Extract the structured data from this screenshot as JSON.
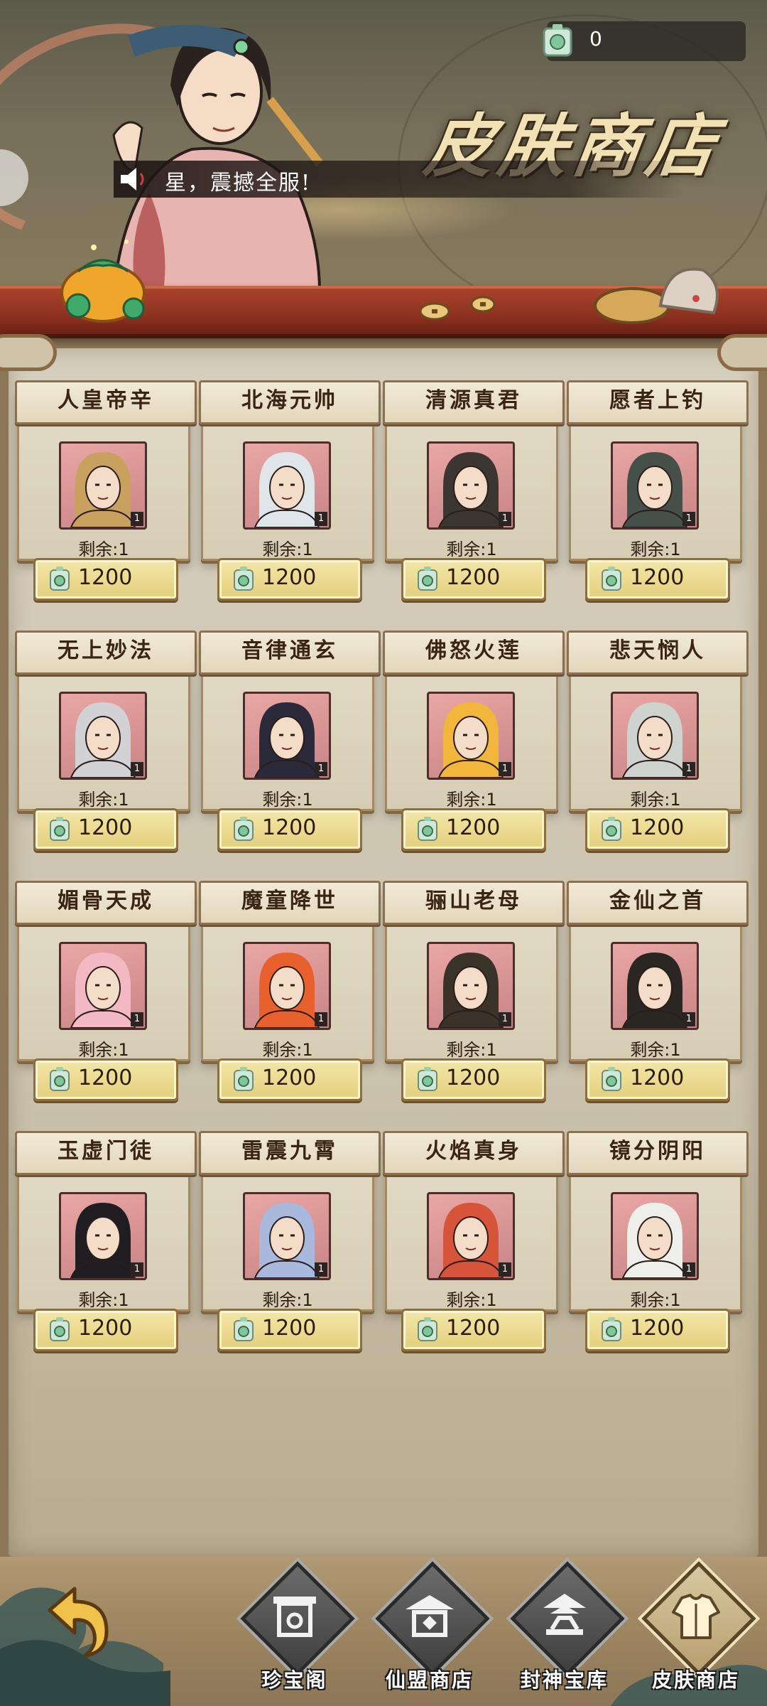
{
  "header": {
    "currency_value": "0",
    "shop_title": "皮肤商店",
    "announcement": "星，震撼全服!",
    "icons": [
      "jade-currency-icon",
      "speaker-icon",
      "money-bag-icon",
      "coins-icon",
      "sack-icon"
    ]
  },
  "items": [
    {
      "name": "人皇帝辛",
      "remaining": "剩余:1",
      "price": "1200",
      "stock": "1",
      "tone": "#c9a15e"
    },
    {
      "name": "北海元帅",
      "remaining": "剩余:1",
      "price": "1200",
      "stock": "1",
      "tone": "#dfe6ea"
    },
    {
      "name": "清源真君",
      "remaining": "剩余:1",
      "price": "1200",
      "stock": "1",
      "tone": "#3b3631"
    },
    {
      "name": "愿者上钓",
      "remaining": "剩余:1",
      "price": "1200",
      "stock": "1",
      "tone": "#46504a"
    },
    {
      "name": "无上妙法",
      "remaining": "剩余:1",
      "price": "1200",
      "stock": "1",
      "tone": "#d2d2d6"
    },
    {
      "name": "音律通玄",
      "remaining": "剩余:1",
      "price": "1200",
      "stock": "1",
      "tone": "#2b2a3a"
    },
    {
      "name": "佛怒火莲",
      "remaining": "剩余:1",
      "price": "1200",
      "stock": "1",
      "tone": "#f2b63a"
    },
    {
      "name": "悲天悯人",
      "remaining": "剩余:1",
      "price": "1200",
      "stock": "1",
      "tone": "#cfd3cf"
    },
    {
      "name": "媚骨天成",
      "remaining": "剩余:1",
      "price": "1200",
      "stock": "1",
      "tone": "#f3b9c2"
    },
    {
      "name": "魔童降世",
      "remaining": "剩余:1",
      "price": "1200",
      "stock": "1",
      "tone": "#e8612c"
    },
    {
      "name": "骊山老母",
      "remaining": "剩余:1",
      "price": "1200",
      "stock": "1",
      "tone": "#3a3329"
    },
    {
      "name": "金仙之首",
      "remaining": "剩余:1",
      "price": "1200",
      "stock": "1",
      "tone": "#2a2622"
    },
    {
      "name": "玉虚门徒",
      "remaining": "剩余:1",
      "price": "1200",
      "stock": "1",
      "tone": "#1f1c22"
    },
    {
      "name": "雷震九霄",
      "remaining": "剩余:1",
      "price": "1200",
      "stock": "1",
      "tone": "#a9b9dd"
    },
    {
      "name": "火焰真身",
      "remaining": "剩余:1",
      "price": "1200",
      "stock": "1",
      "tone": "#d6553a"
    },
    {
      "name": "镜分阴阳",
      "remaining": "剩余:1",
      "price": "1200",
      "stock": "1",
      "tone": "#eeeeea"
    }
  ],
  "nav": {
    "back_icon": "back-arrow-icon",
    "tabs": [
      {
        "label": "珍宝阁",
        "icon": "treasure-pavilion-icon",
        "active": false
      },
      {
        "label": "仙盟商店",
        "icon": "guild-shop-icon",
        "active": false
      },
      {
        "label": "封神宝库",
        "icon": "vault-icon",
        "active": false
      },
      {
        "label": "皮肤商店",
        "icon": "skin-shop-icon",
        "active": true
      }
    ]
  },
  "colors": {
    "panel": "#d7cfbd",
    "shelf": "#8e3121",
    "price_button": "#e4cf7c",
    "title_text": "#3a2512"
  }
}
